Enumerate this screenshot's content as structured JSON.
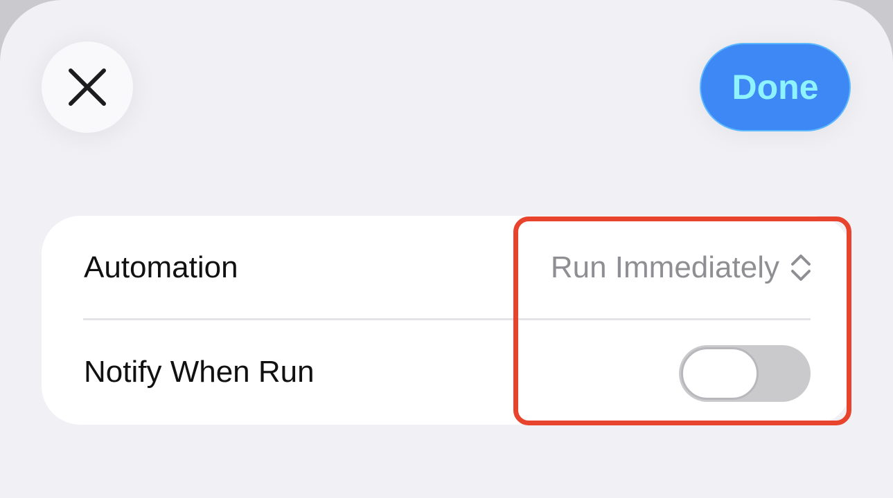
{
  "header": {
    "close_icon": "close-x-icon",
    "done_label": "Done"
  },
  "settings": {
    "automation": {
      "label": "Automation",
      "value": "Run Immediately",
      "icon": "chevron-up-down-icon"
    },
    "notify": {
      "label": "Notify When Run",
      "toggle_on": false
    }
  },
  "colors": {
    "accent": "#3d88f5",
    "done_text": "#8ff3ff",
    "highlight": "#e8432c",
    "toggle_off": "#cacacc"
  }
}
